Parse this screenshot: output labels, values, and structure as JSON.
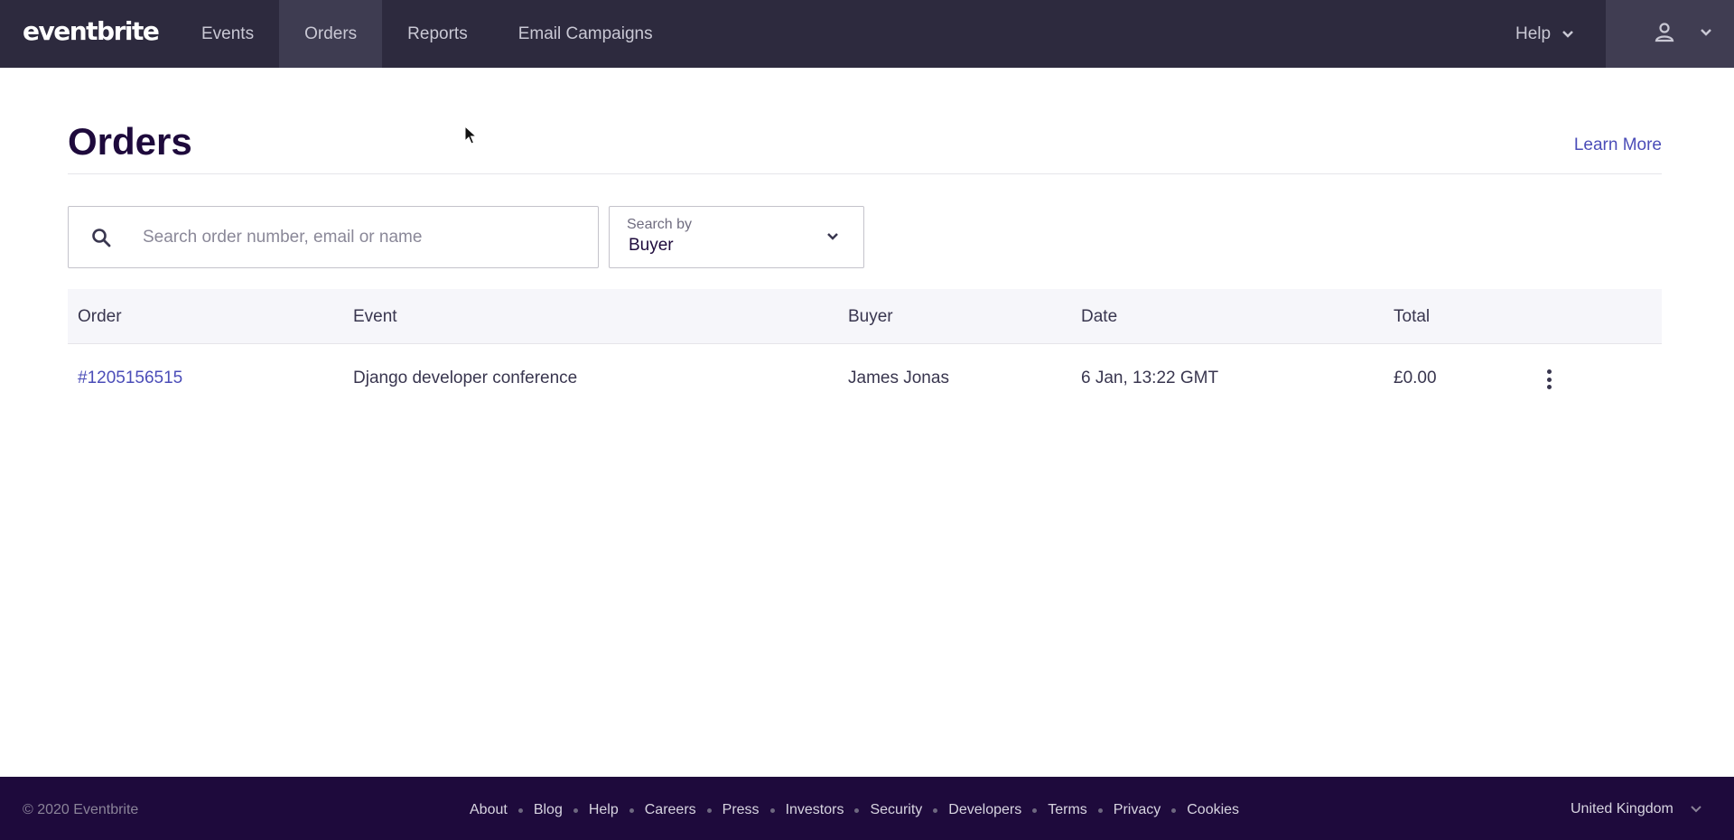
{
  "topbar": {
    "logo": "eventbrite",
    "nav": [
      {
        "label": "Events",
        "active": false
      },
      {
        "label": "Orders",
        "active": true
      },
      {
        "label": "Reports",
        "active": false
      },
      {
        "label": "Email Campaigns",
        "active": false
      }
    ],
    "help_label": "Help",
    "account_icon": "user-icon"
  },
  "page": {
    "title": "Orders",
    "learn_more": "Learn More"
  },
  "search": {
    "placeholder": "Search order number, email or name",
    "value": "",
    "search_by_label": "Search by",
    "search_by_value": "Buyer"
  },
  "table": {
    "columns": [
      "Order",
      "Event",
      "Buyer",
      "Date",
      "Total"
    ],
    "rows": [
      {
        "order": "#1205156515",
        "event": "Django developer conference",
        "buyer": "James Jonas",
        "date": "6 Jan, 13:22 GMT",
        "total": "£0.00"
      }
    ]
  },
  "footer": {
    "copyright": "© 2020 Eventbrite",
    "links": [
      "About",
      "Blog",
      "Help",
      "Careers",
      "Press",
      "Investors",
      "Security",
      "Developers",
      "Terms",
      "Privacy",
      "Cookies"
    ],
    "country": "United Kingdom"
  }
}
